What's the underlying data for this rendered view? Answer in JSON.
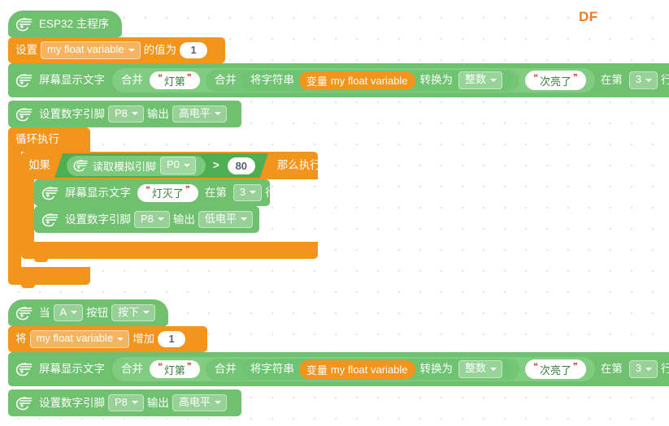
{
  "brand": {
    "label": "DF",
    "color": "#ef7c2a"
  },
  "editor": {
    "background_color": "#ffffff",
    "grid_dot_color": "#e3e3e3",
    "block_colors": {
      "green": "#6fc06f",
      "orange": "#f3941d",
      "boolean_green": "#4fae52",
      "reporter_green": "#79c87a"
    }
  },
  "icons": {
    "board": "esp32-swoosh-icon",
    "caret": "chevron-down-icon"
  },
  "scripts": [
    {
      "id": "main-program",
      "hat": {
        "text": "ESP32 主程序"
      },
      "blocks": [
        {
          "id": "set-variable",
          "type": "variable-set",
          "color": "orange",
          "prefix": "设置",
          "variable": "my float variable",
          "middle": "的值为",
          "value": "1"
        },
        {
          "id": "display-text-1",
          "type": "screen-display",
          "color": "green",
          "prefix": "屏幕显示文字",
          "join_outer": "合并",
          "string_1": "灯第",
          "join_inner": "合并",
          "convert_label": "将字符串",
          "variable_label": "变量",
          "variable": "my float variable",
          "convert_to": "转换为",
          "convert_type": "整数",
          "string_2": "次亮了",
          "line_prefix": "在第",
          "line": "3",
          "line_suffix": "行"
        },
        {
          "id": "digital-write-1",
          "type": "digital-write",
          "color": "green",
          "prefix": "设置数字引脚",
          "pin": "P8",
          "middle": "输出",
          "level": "高电平"
        },
        {
          "id": "forever-loop",
          "type": "loop",
          "color": "orange",
          "label": "循环执行",
          "children": [
            {
              "id": "if-block",
              "type": "if",
              "color": "orange",
              "label_if": "如果",
              "label_then": "那么执行",
              "condition": {
                "reporter_prefix": "读取模拟引脚",
                "pin": "P0",
                "operator": ">",
                "operand": "80"
              },
              "children": [
                {
                  "id": "display-text-2",
                  "type": "screen-display-simple",
                  "color": "green",
                  "prefix": "屏幕显示文字",
                  "text": "灯灭了",
                  "line_prefix": "在第",
                  "line": "3",
                  "line_suffix": "行"
                },
                {
                  "id": "digital-write-2",
                  "type": "digital-write",
                  "color": "green",
                  "prefix": "设置数字引脚",
                  "pin": "P8",
                  "middle": "输出",
                  "level": "低电平"
                }
              ]
            }
          ]
        }
      ]
    },
    {
      "id": "button-event",
      "hat": {
        "prefix": "当",
        "button": "A",
        "middle": "按钮",
        "action": "按下"
      },
      "blocks": [
        {
          "id": "change-variable",
          "type": "variable-change",
          "color": "orange",
          "prefix": "将",
          "variable": "my float variable",
          "middle": "增加",
          "value": "1"
        },
        {
          "id": "display-text-3",
          "type": "screen-display",
          "color": "green",
          "prefix": "屏幕显示文字",
          "join_outer": "合并",
          "string_1": "灯第",
          "join_inner": "合并",
          "convert_label": "将字符串",
          "variable_label": "变量",
          "variable": "my float variable",
          "convert_to": "转换为",
          "convert_type": "整数",
          "string_2": "次亮了",
          "line_prefix": "在第",
          "line": "3",
          "line_suffix": "行"
        },
        {
          "id": "digital-write-3",
          "type": "digital-write",
          "color": "green",
          "prefix": "设置数字引脚",
          "pin": "P8",
          "middle": "输出",
          "level": "高电平"
        }
      ]
    }
  ]
}
